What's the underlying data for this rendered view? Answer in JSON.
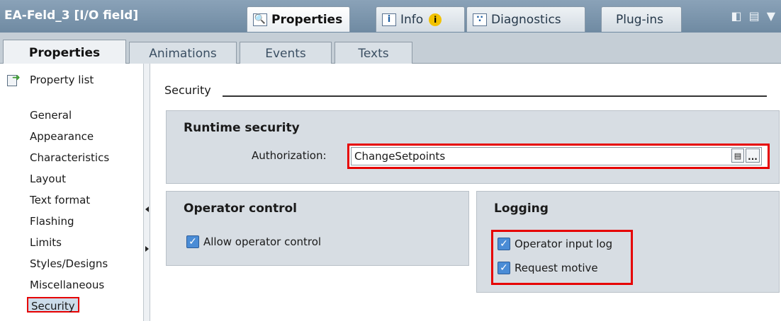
{
  "window": {
    "object_title": "EA-Feld_3 [I/O field]",
    "tabs": [
      {
        "label": "Properties",
        "icon": "magnifier-document-icon"
      },
      {
        "label": "Info",
        "icon": "info-table-icon",
        "badge": "i"
      },
      {
        "label": "Diagnostics",
        "icon": "diagnostics-icon"
      },
      {
        "label": "Plug-ins"
      }
    ],
    "controls": [
      "window-restore-icon",
      "layout-list-icon",
      "dropdown-arrow-icon"
    ]
  },
  "subtabs": [
    {
      "label": "Properties",
      "active": true
    },
    {
      "label": "Animations"
    },
    {
      "label": "Events"
    },
    {
      "label": "Texts"
    }
  ],
  "nav": {
    "header": "Property list",
    "items": [
      "General",
      "Appearance",
      "Characteristics",
      "Layout",
      "Text format",
      "Flashing",
      "Limits",
      "Styles/Designs",
      "Miscellaneous",
      "Security"
    ],
    "selected": "Security"
  },
  "section": {
    "title": "Security",
    "runtime": {
      "title": "Runtime security",
      "authorization_label": "Authorization:",
      "authorization_value": "ChangeSetpoints",
      "browse_label": "..."
    },
    "operator_control": {
      "title": "Operator control",
      "allow_label": "Allow operator control",
      "allow_checked": true
    },
    "logging": {
      "title": "Logging",
      "input_log_label": "Operator input log",
      "input_log_checked": true,
      "request_motive_label": "Request motive",
      "request_motive_checked": true
    }
  },
  "colors": {
    "highlight_red": "#e60000",
    "title_bar": "#7d96ad",
    "group_bg": "#d7dde3",
    "checkbox_blue": "#4a8cd6"
  }
}
